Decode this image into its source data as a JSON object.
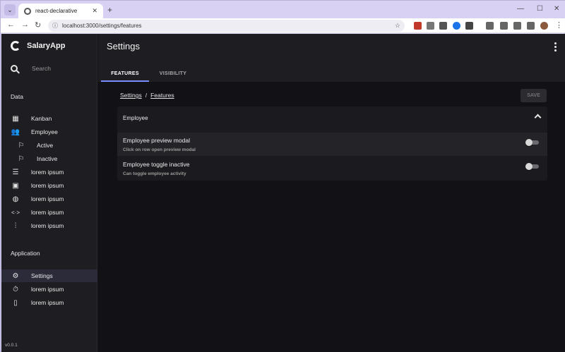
{
  "browser": {
    "tab_title": "react-declarative",
    "url": "localhost:3000/settings/features"
  },
  "app": {
    "name": "SalaryApp",
    "search_placeholder": "Search",
    "version": "v0.0.1"
  },
  "sidebar": {
    "sections": [
      {
        "label": "Data",
        "items": [
          {
            "label": "Kanban",
            "icon": "dashboard-icon"
          },
          {
            "label": "Employee",
            "icon": "people-icon"
          },
          {
            "label": "Active",
            "icon": "flag-icon"
          },
          {
            "label": "Inactive",
            "icon": "flag-icon"
          },
          {
            "label": "lorem ipsum",
            "icon": "dns-icon"
          },
          {
            "label": "lorem ipsum",
            "icon": "image-icon"
          },
          {
            "label": "lorem ipsum",
            "icon": "globe-icon"
          },
          {
            "label": "lorem ipsum",
            "icon": "code-icon"
          },
          {
            "label": "lorem ipsum",
            "icon": "equalizer-icon"
          }
        ]
      },
      {
        "label": "Application",
        "items": [
          {
            "label": "Settings",
            "icon": "gear-icon"
          },
          {
            "label": "lorem ipsum",
            "icon": "timer-icon"
          },
          {
            "label": "lorem ipsum",
            "icon": "phonelink-icon"
          }
        ]
      }
    ]
  },
  "header": {
    "title": "Settings",
    "tabs": [
      {
        "label": "FEATURES",
        "active": true
      },
      {
        "label": "VISIBILITY",
        "active": false
      }
    ]
  },
  "content": {
    "breadcrumb": [
      "Settings",
      "Features"
    ],
    "save_label": "SAVE",
    "panel": {
      "title": "Employee",
      "rows": [
        {
          "title": "Employee preview modal",
          "description": "Click on row open preview modal",
          "enabled": false
        },
        {
          "title": "Employee toggle inactive",
          "description": "Can toggle employee activity",
          "enabled": false
        }
      ]
    }
  },
  "colors": {
    "accent": "#7b8cff",
    "background": "#121216",
    "sidebar": "#1e1e22"
  }
}
